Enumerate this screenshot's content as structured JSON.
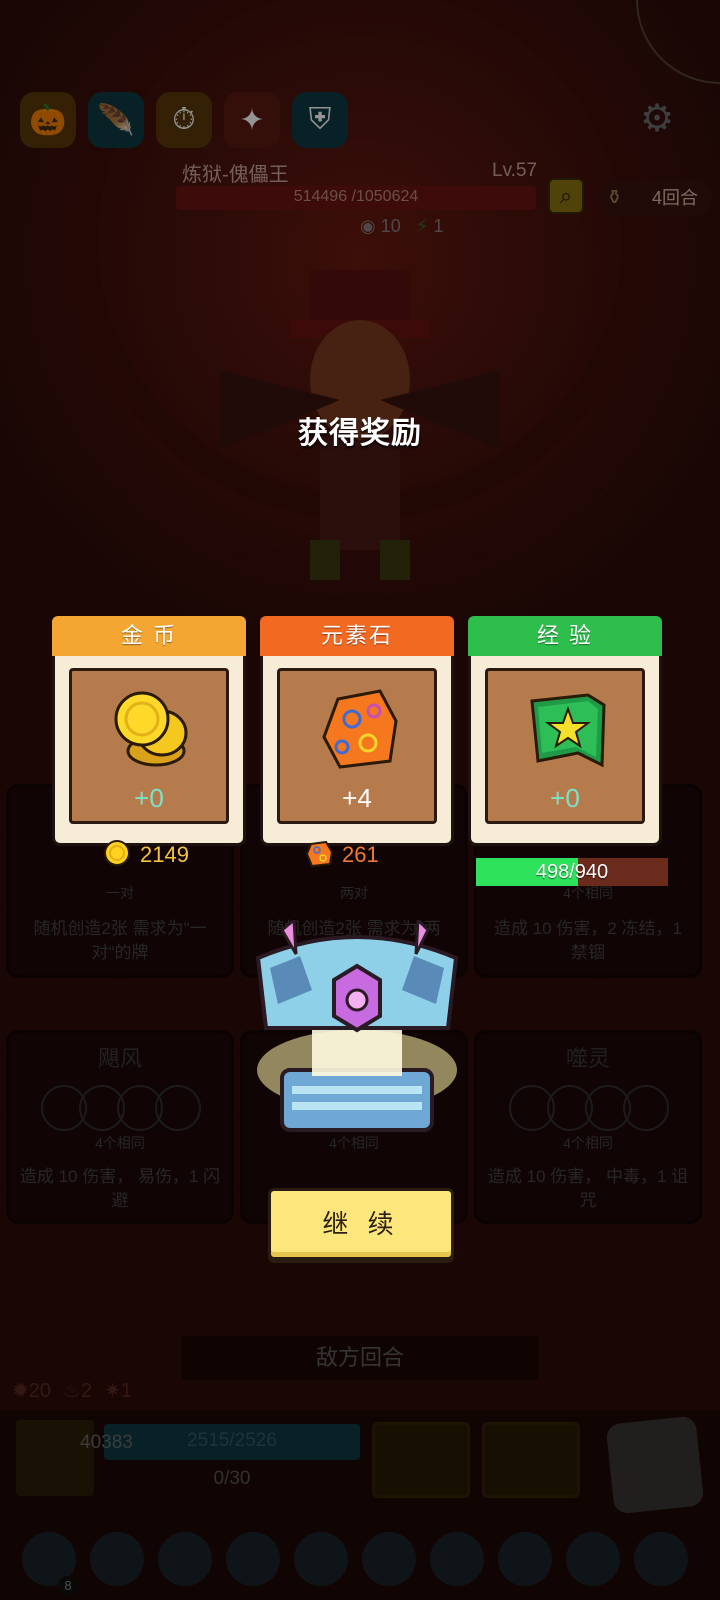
{
  "boss": {
    "name": "炼狱-傀儡王",
    "level": "Lv.57",
    "hp": "514496 /1050624",
    "stat_a": "10",
    "stat_b": "1"
  },
  "round": "4回合",
  "background_cards": [
    {
      "name": "一对",
      "desc": "随机创造2张 需求为\"一对\"的牌"
    },
    {
      "name": "两对",
      "desc": "随机创造2张 需求为\"两对\"的牌"
    },
    {
      "name": "4个相同",
      "desc": "造成 10 伤害，2 冻结，1 禁锢"
    },
    {
      "name": "飓风",
      "sub": "4个相同",
      "desc": "造成 10 伤害， 易伤，1 闪避"
    },
    {
      "name": "4个相同",
      "desc": ""
    },
    {
      "name": "噬灵",
      "sub": "4个相同",
      "desc": "造成 10 伤害， 中毒，1 诅咒"
    }
  ],
  "enemy_turn": "敌方回合",
  "status": {
    "a": "20",
    "b": "2",
    "c": "1"
  },
  "player": {
    "defense": "40383",
    "hp": "2515/2526",
    "mana": "0/30"
  },
  "tray_badge": "8",
  "overlay": {
    "title": "获得奖励",
    "rewards": [
      {
        "label": "金 币",
        "amount": "+0",
        "header_color": "#f3a632",
        "amount_color": "#7de0c8"
      },
      {
        "label": "元素石",
        "amount": "+4",
        "header_color": "#f26a22",
        "amount_color": "#ffffff"
      },
      {
        "label": "经 验",
        "amount": "+0",
        "header_color": "#2ebe4c",
        "amount_color": "#7de0c8"
      }
    ],
    "totals": {
      "gold": "2149",
      "stone": "261",
      "xp_text": "498/940",
      "xp_fraction": 0.53
    },
    "continue_label": "继 续"
  },
  "colors": {
    "gold_text": "#f6c43c",
    "stone_text": "#f07a36",
    "xp_fill": "#2ee25c"
  }
}
